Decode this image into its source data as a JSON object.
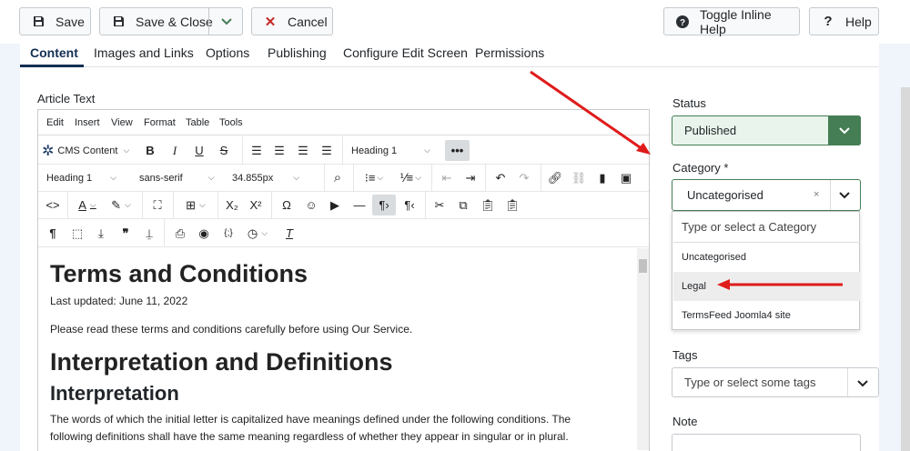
{
  "toolbar": {
    "save": "Save",
    "save_close": "Save & Close",
    "cancel": "Cancel",
    "toggle_help": "Toggle Inline Help",
    "help": "Help"
  },
  "tabs": [
    "Content",
    "Images and Links",
    "Options",
    "Publishing",
    "Configure Edit Screen",
    "Permissions"
  ],
  "editor": {
    "label": "Article Text",
    "menu": [
      "Edit",
      "Insert",
      "View",
      "Format",
      "Table",
      "Tools"
    ],
    "cms_content": "CMS Content",
    "block_format": "Heading 1",
    "format2": "Heading 1",
    "font": "sans-serif",
    "font_size": "34.855px",
    "content": {
      "h1": "Terms and Conditions",
      "updated": "Last updated: June 11, 2022",
      "intro": "Please read these terms and conditions carefully before using Our Service.",
      "h1b": "Interpretation and Definitions",
      "h2": "Interpretation",
      "para_line1": "The words of which the initial letter is capitalized have meanings defined under the following conditions. The",
      "para_line2": "following definitions shall have the same meaning regardless of whether they appear in singular or in plural."
    }
  },
  "sidebar": {
    "status_label": "Status",
    "status_value": "Published",
    "category_label": "Category *",
    "category_value": "Uncategorised",
    "category_placeholder": "Type or select a Category",
    "category_options": [
      "Uncategorised",
      "Legal",
      "TermsFeed Joomla4 site"
    ],
    "tags_label": "Tags",
    "tags_placeholder": "Type or select some tags",
    "note_label": "Note"
  },
  "colors": {
    "accent": "#457d54",
    "annotation": "#e01b1b",
    "brand_text": "#132f53"
  }
}
